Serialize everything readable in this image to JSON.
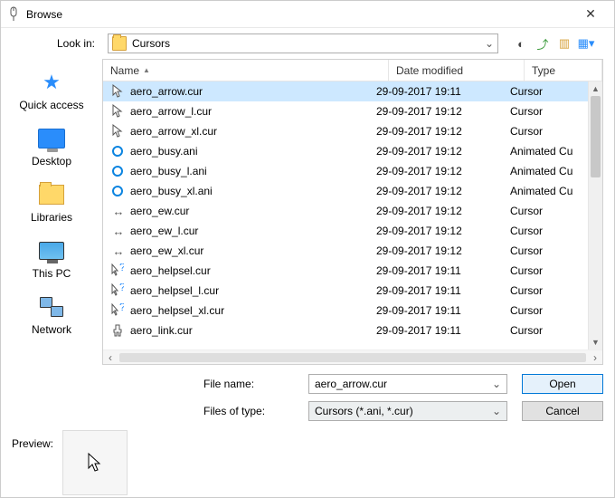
{
  "title": "Browse",
  "lookin": {
    "label": "Look in:",
    "value": "Cursors"
  },
  "toolbar_icons": {
    "back": "back-icon",
    "up": "up-icon",
    "newfolder": "new-folder-icon",
    "view": "view-menu-icon"
  },
  "places": [
    {
      "id": "quick-access",
      "label": "Quick access"
    },
    {
      "id": "desktop",
      "label": "Desktop"
    },
    {
      "id": "libraries",
      "label": "Libraries"
    },
    {
      "id": "this-pc",
      "label": "This PC"
    },
    {
      "id": "network",
      "label": "Network"
    }
  ],
  "columns": {
    "name": "Name",
    "date": "Date modified",
    "type": "Type"
  },
  "files": [
    {
      "icon": "arrow",
      "name": "aero_arrow.cur",
      "date": "29-09-2017 19:11",
      "type": "Cursor",
      "selected": true
    },
    {
      "icon": "arrow",
      "name": "aero_arrow_l.cur",
      "date": "29-09-2017 19:12",
      "type": "Cursor"
    },
    {
      "icon": "arrow",
      "name": "aero_arrow_xl.cur",
      "date": "29-09-2017 19:12",
      "type": "Cursor"
    },
    {
      "icon": "busy",
      "name": "aero_busy.ani",
      "date": "29-09-2017 19:12",
      "type": "Animated Cu"
    },
    {
      "icon": "busy",
      "name": "aero_busy_l.ani",
      "date": "29-09-2017 19:12",
      "type": "Animated Cu"
    },
    {
      "icon": "busy",
      "name": "aero_busy_xl.ani",
      "date": "29-09-2017 19:12",
      "type": "Animated Cu"
    },
    {
      "icon": "ew",
      "name": "aero_ew.cur",
      "date": "29-09-2017 19:12",
      "type": "Cursor"
    },
    {
      "icon": "ew",
      "name": "aero_ew_l.cur",
      "date": "29-09-2017 19:12",
      "type": "Cursor"
    },
    {
      "icon": "ew",
      "name": "aero_ew_xl.cur",
      "date": "29-09-2017 19:12",
      "type": "Cursor"
    },
    {
      "icon": "helpsel",
      "name": "aero_helpsel.cur",
      "date": "29-09-2017 19:11",
      "type": "Cursor"
    },
    {
      "icon": "helpsel",
      "name": "aero_helpsel_l.cur",
      "date": "29-09-2017 19:11",
      "type": "Cursor"
    },
    {
      "icon": "helpsel",
      "name": "aero_helpsel_xl.cur",
      "date": "29-09-2017 19:11",
      "type": "Cursor"
    },
    {
      "icon": "link",
      "name": "aero_link.cur",
      "date": "29-09-2017 19:11",
      "type": "Cursor"
    }
  ],
  "form": {
    "filename_label": "File name:",
    "filename_value": "aero_arrow.cur",
    "filter_label": "Files of type:",
    "filter_value": "Cursors (*.ani, *.cur)",
    "open": "Open",
    "cancel": "Cancel"
  },
  "preview": {
    "label": "Preview:"
  }
}
